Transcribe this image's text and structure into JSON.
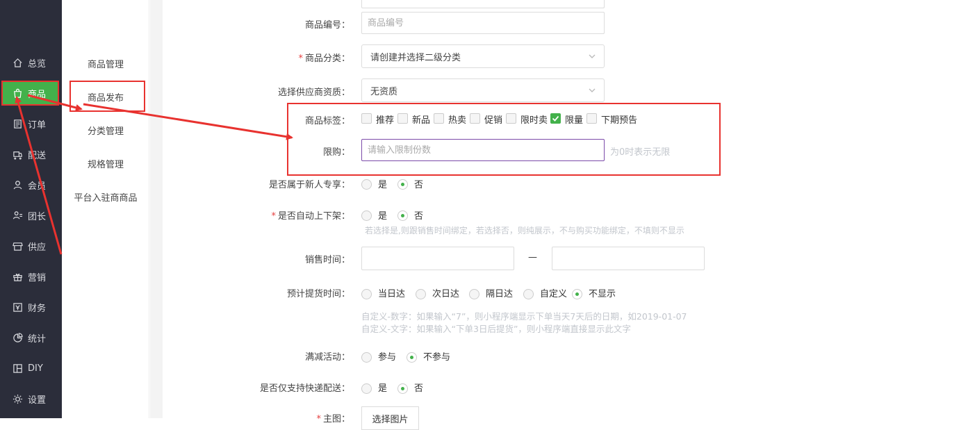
{
  "nav": [
    {
      "label": "总览",
      "icon": "home-icon"
    },
    {
      "label": "商品",
      "icon": "bag-icon"
    },
    {
      "label": "订单",
      "icon": "order-icon"
    },
    {
      "label": "配送",
      "icon": "delivery-icon"
    },
    {
      "label": "会员",
      "icon": "user-icon"
    },
    {
      "label": "团长",
      "icon": "leader-icon"
    },
    {
      "label": "供应",
      "icon": "store-icon"
    },
    {
      "label": "营销",
      "icon": "gift-icon"
    },
    {
      "label": "财务",
      "icon": "yen-icon"
    },
    {
      "label": "统计",
      "icon": "pie-icon"
    },
    {
      "label": "DIY",
      "icon": "layout-icon"
    },
    {
      "label": "设置",
      "icon": "gear-icon"
    }
  ],
  "subnav": [
    "商品管理",
    "商品发布",
    "分类管理",
    "规格管理",
    "平台入驻商商品"
  ],
  "form": {
    "code_label": "商品编号：",
    "code_placeholder": "商品编号",
    "category_label": "商品分类：",
    "category_value": "请创建并选择二级分类",
    "supplier_label": "选择供应商资质：",
    "supplier_value": "无资质",
    "tags_label": "商品标签：",
    "tags": [
      {
        "label": "推荐",
        "checked": false
      },
      {
        "label": "新品",
        "checked": false
      },
      {
        "label": "热卖",
        "checked": false
      },
      {
        "label": "促销",
        "checked": false
      },
      {
        "label": "限时卖",
        "checked": false
      },
      {
        "label": "限量",
        "checked": true
      },
      {
        "label": "下期预告",
        "checked": false
      }
    ],
    "limit_label": "限购：",
    "limit_placeholder": "请输入限制份数",
    "limit_hint": "为0时表示无限",
    "newbie_label": "是否属于新人专享：",
    "auto_shelf_label": "是否自动上下架：",
    "auto_shelf_hint": "若选择是,则跟销售时间绑定，若选择否，则纯展示，不与购买功能绑定，不填则不显示",
    "yes": "是",
    "no": "否",
    "sale_time_label": "销售时间：",
    "sale_time_sep": "—",
    "pickup_label": "预计提货时间：",
    "pickup_options": [
      "当日达",
      "次日达",
      "隔日达",
      "自定义",
      "不显示"
    ],
    "pickup_selected": 4,
    "pickup_hint1": "自定义-数字：如果输入“7”，则小程序端显示下单当天7天后的日期，如2019-01-07",
    "pickup_hint2": "自定义-文字：如果输入“下单3日后提货”，则小程序端直接显示此文字",
    "fullcut_label": "满减活动：",
    "fullcut_join": "参与",
    "fullcut_nojoin": "不参与",
    "express_label": "是否仅支持快递配送：",
    "main_image_label": "主图：",
    "choose_image": "选择图片"
  },
  "colors": {
    "accent": "#43b14b",
    "highlight": "#e8322f",
    "sidebar": "#2b2d3a"
  }
}
